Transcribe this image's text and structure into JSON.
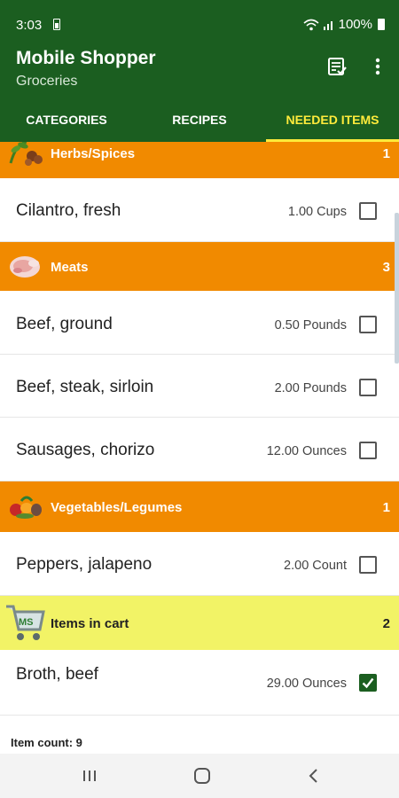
{
  "status_bar": {
    "time": "3:03",
    "battery": "100%"
  },
  "app_bar": {
    "title": "Mobile Shopper",
    "subtitle": "Groceries"
  },
  "tabs": [
    {
      "label": "CATEGORIES",
      "active": false
    },
    {
      "label": "RECIPES",
      "active": false
    },
    {
      "label": "NEEDED ITEMS",
      "active": true
    }
  ],
  "categories": [
    {
      "name": "Herbs/Spices",
      "count": "1",
      "icon": "herbs-icon",
      "items": [
        {
          "name": "Cilantro, fresh",
          "quantity": "1.00 Cups",
          "checked": false
        }
      ]
    },
    {
      "name": "Meats",
      "count": "3",
      "icon": "meat-icon",
      "items": [
        {
          "name": "Beef, ground",
          "quantity": "0.50 Pounds",
          "checked": false
        },
        {
          "name": "Beef, steak, sirloin",
          "quantity": "2.00 Pounds",
          "checked": false
        },
        {
          "name": "Sausages, chorizo",
          "quantity": "12.00 Ounces",
          "checked": false
        }
      ]
    },
    {
      "name": "Vegetables/Legumes",
      "count": "1",
      "icon": "vegetables-icon",
      "items": [
        {
          "name": "Peppers, jalapeno",
          "quantity": "2.00 Count",
          "checked": false
        }
      ]
    }
  ],
  "cart": {
    "name": "Items in cart",
    "count": "2",
    "icon": "shopping-cart-icon",
    "items": [
      {
        "name": "Broth, beef",
        "quantity": "29.00 Ounces",
        "checked": true
      }
    ]
  },
  "footer": {
    "item_count_text": "Item count: 9"
  },
  "colors": {
    "primary": "#1b5e20",
    "accent_tab": "#ffeb3b",
    "category_header": "#f18a00",
    "cart_header": "#f2f366"
  }
}
